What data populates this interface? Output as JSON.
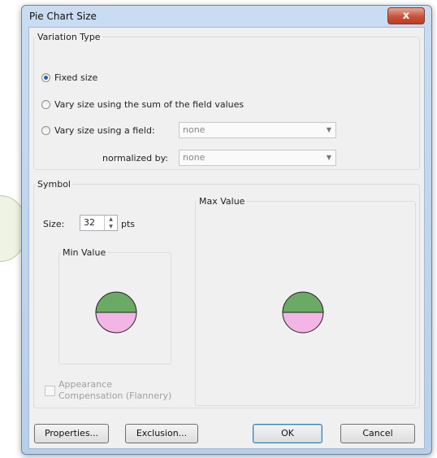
{
  "window": {
    "title": "Pie Chart Size",
    "close_label": "x"
  },
  "variation": {
    "legend": "Variation Type",
    "options": [
      {
        "label": "Fixed size",
        "checked": true
      },
      {
        "label": "Vary size using the sum of the field values",
        "checked": false
      },
      {
        "label": "Vary size using a field:",
        "checked": false
      }
    ],
    "field_value": "none",
    "normalized_label": "normalized by:",
    "normalized_value": "none"
  },
  "symbol": {
    "legend": "Symbol",
    "size_label": "Size:",
    "size_value": "32",
    "size_unit": "pts",
    "min_legend": "Min Value",
    "max_legend": "Max Value",
    "pie_colors": {
      "top": "#6aaa64",
      "bottom": "#f3b6e4",
      "outline": "#222222"
    },
    "appearance_label_1": "Appearance",
    "appearance_label_2": "Compensation (Flannery)",
    "appearance_checked": false
  },
  "buttons": {
    "properties": "Properties...",
    "exclusion": "Exclusion...",
    "ok": "OK",
    "cancel": "Cancel"
  }
}
